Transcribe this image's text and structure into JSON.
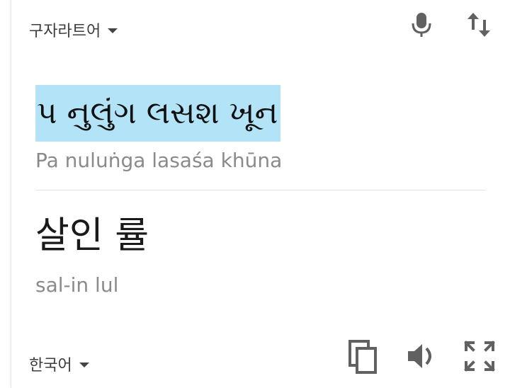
{
  "source": {
    "language": "구자라트어",
    "text": "પ નુલુંગ લસશ ખૂન",
    "transliteration": "Pa nuluṅga lasaśa khūna"
  },
  "target": {
    "language": "한국어",
    "text": "살인 률",
    "transliteration": "sal-in lul"
  },
  "icons": {
    "source_dropdown": "chevron-down-icon",
    "microphone": "microphone-icon",
    "swap": "swap-languages-icon",
    "target_dropdown": "chevron-down-icon",
    "copy": "copy-icon",
    "speaker": "speaker-icon",
    "fullscreen": "fullscreen-icon"
  },
  "colors": {
    "highlight": "#b3e3f7",
    "icon": "#616161",
    "muted_text": "#8a8a8a"
  }
}
